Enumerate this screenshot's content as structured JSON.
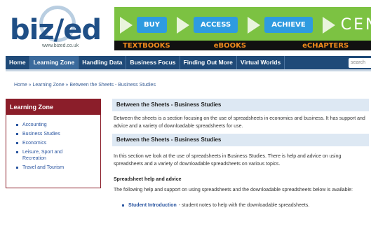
{
  "logo": {
    "text": "biz/ed",
    "subtext": "www.bized.co.uk"
  },
  "banner": {
    "buttons": [
      "BUY",
      "ACCESS",
      "ACHIEVE"
    ],
    "brand": "CENG",
    "strip": [
      "TEXTBOOKS",
      "eBOOKS",
      "eCHAPTERS"
    ]
  },
  "nav": {
    "items": [
      "Home",
      "Learning Zone",
      "Handling Data",
      "Business Focus",
      "Finding Out More",
      "Virtual Worlds"
    ],
    "search_placeholder": "search"
  },
  "breadcrumb": "Home » Learning Zone » Between the Sheets - Business Studies",
  "sidebar": {
    "title": "Learning Zone",
    "items": [
      "Accounting",
      "Business Studies",
      "Economics",
      "Leisure, Sport and Recreation",
      "Travel and Tourism"
    ]
  },
  "main": {
    "heading1": "Between the Sheets - Business Studies",
    "intro": "Between the sheets is a section focusing on the use of spreadsheets in economics and business. It has support and advice and a variety of downloadable spreadsheets for use.",
    "heading2": "Between the Sheets - Business Studies",
    "para2": "In this section we look at the use of spreadsheets in Business Studies. There is help and advice on using spreadsheets and a variety of downloadable spreadsheets on various topics.",
    "subhead": "Spreadsheet help and advice",
    "para3": "The following help and support on using spreadsheets and the downloadable spreadsheets below is available:",
    "bullet_link": "Student Introduction",
    "bullet_text": "- student notes to help with the downloadable spreadsheets."
  }
}
